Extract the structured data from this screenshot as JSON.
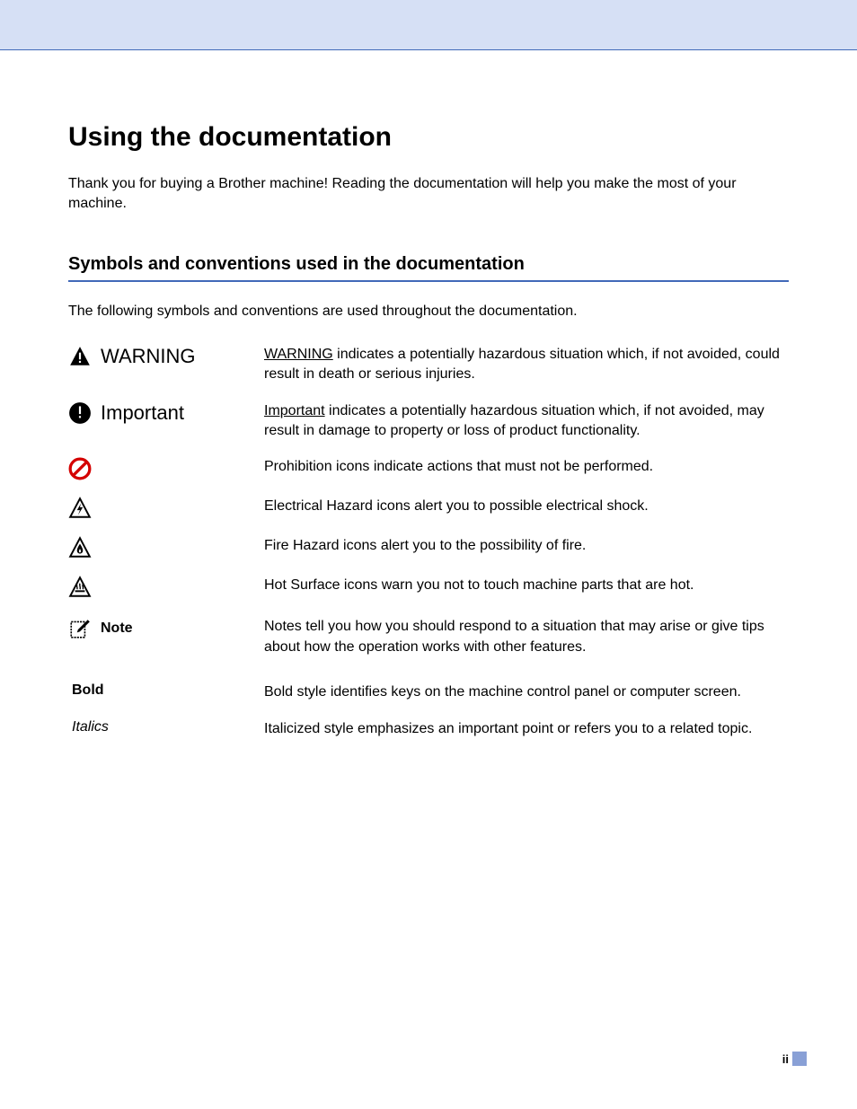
{
  "heading": "Using the documentation",
  "intro": "Thank you for buying a Brother machine! Reading the documentation will help you make the most of your machine.",
  "subheading": "Symbols and conventions used in the documentation",
  "lead": "The following symbols and conventions are used throughout the documentation.",
  "rows": {
    "warning": {
      "label": "WARNING",
      "desc_prefix": "WARNING",
      "desc_rest": " indicates a potentially hazardous situation which, if not avoided, could result in death or serious injuries."
    },
    "important": {
      "label": "Important",
      "desc_prefix": "Important",
      "desc_rest": " indicates a potentially hazardous situation which, if not avoided, may result in damage to property or loss of product functionality."
    },
    "prohibition": {
      "desc": "Prohibition icons indicate actions that must not be performed."
    },
    "electrical": {
      "desc": "Electrical Hazard icons alert you to possible electrical shock."
    },
    "fire": {
      "desc": "Fire Hazard icons alert you to the possibility of fire."
    },
    "hot": {
      "desc": "Hot Surface icons warn you not to touch machine parts that are hot."
    },
    "note": {
      "label": "Note",
      "desc": "Notes tell you how you should respond to a situation that may arise or give tips about how the operation works with other features."
    },
    "bold": {
      "label": "Bold",
      "desc": "Bold style identifies keys on the machine control panel or computer screen."
    },
    "italics": {
      "label": "Italics",
      "desc": "Italicized style emphasizes an important point or refers you to a related topic."
    }
  },
  "page_number": "ii"
}
